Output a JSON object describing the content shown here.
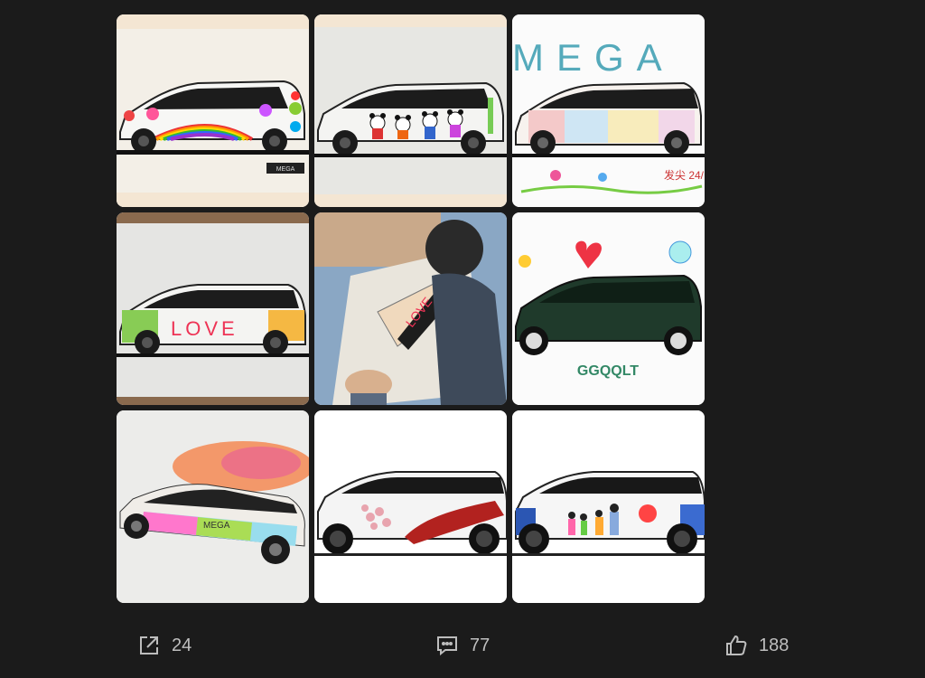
{
  "post": {
    "image_count": 9,
    "images": [
      {
        "caption": "",
        "drawn_text": ""
      },
      {
        "caption": "",
        "drawn_text": ""
      },
      {
        "caption": "",
        "drawn_text": "MEGA"
      },
      {
        "caption": "",
        "drawn_text": "LOVE"
      },
      {
        "caption": "",
        "drawn_text": "LOVE"
      },
      {
        "caption": "",
        "drawn_text": "GGQQLT"
      },
      {
        "caption": "",
        "drawn_text": "MEGA"
      },
      {
        "caption": "",
        "drawn_text": ""
      },
      {
        "caption": "",
        "drawn_text": ""
      }
    ],
    "tile3_signature": "发尖 24/",
    "tile1_plate": "MEGA"
  },
  "actions": {
    "share": {
      "icon": "share-icon",
      "count": "24"
    },
    "comment": {
      "icon": "comment-icon",
      "count": "77"
    },
    "like": {
      "icon": "thumbs-up-icon",
      "count": "188"
    }
  },
  "colors": {
    "background": "#1b1b1b",
    "count_text": "#bfbfbf"
  }
}
